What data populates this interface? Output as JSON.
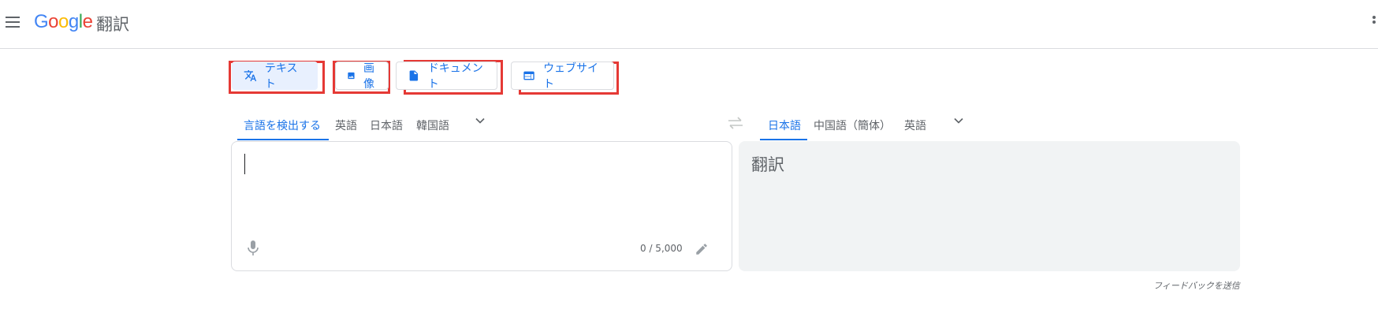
{
  "header": {
    "logo_letters": [
      "G",
      "o",
      "o",
      "g",
      "l",
      "e"
    ],
    "product_name": "翻訳"
  },
  "modes": [
    {
      "label": "テキスト",
      "icon": "translate-icon",
      "active": true
    },
    {
      "label": "画像",
      "icon": "image-icon",
      "active": false
    },
    {
      "label": "ドキュメント",
      "icon": "document-icon",
      "active": false
    },
    {
      "label": "ウェブサイト",
      "icon": "website-icon",
      "active": false
    }
  ],
  "source_languages": [
    {
      "label": "言語を検出する",
      "selected": true
    },
    {
      "label": "英語",
      "selected": false
    },
    {
      "label": "日本語",
      "selected": false
    },
    {
      "label": "韓国語",
      "selected": false
    }
  ],
  "target_languages": [
    {
      "label": "日本語",
      "selected": true
    },
    {
      "label": "中国語（簡体）",
      "selected": false
    },
    {
      "label": "英語",
      "selected": false
    }
  ],
  "source": {
    "value": "",
    "char_count": "0 / 5,000"
  },
  "target": {
    "placeholder": "翻訳"
  },
  "feedback": {
    "label": "フィードバックを送信"
  },
  "colors": {
    "accent": "#1a73e8",
    "highlight": "#e53935",
    "target_bg": "#f1f3f4"
  }
}
